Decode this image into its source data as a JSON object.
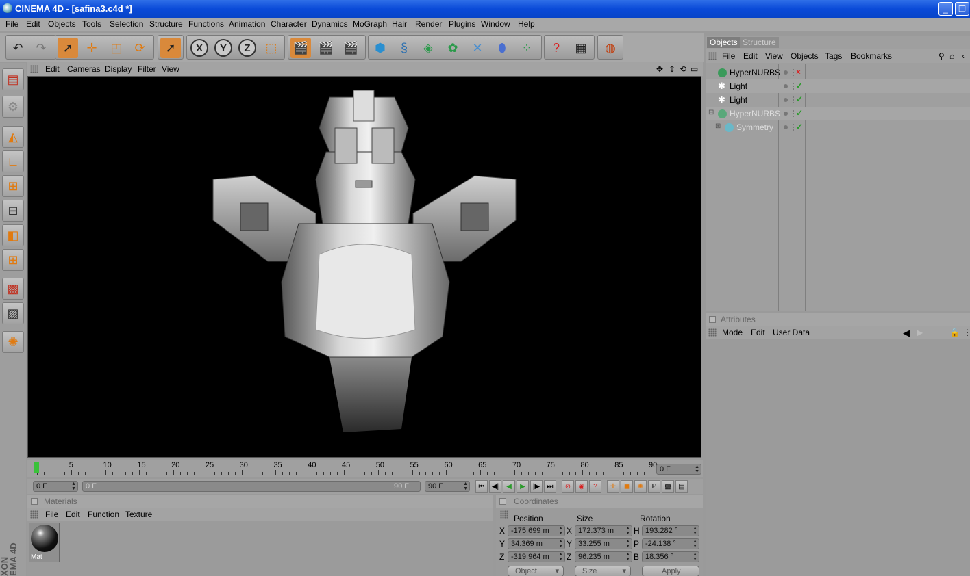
{
  "window": {
    "title": "CINEMA 4D - [safina3.c4d *]"
  },
  "menubar": [
    "File",
    "Edit",
    "Objects",
    "Tools",
    "Selection",
    "Structure",
    "Functions",
    "Animation",
    "Character",
    "Dynamics",
    "MoGraph",
    "Hair",
    "Render",
    "Plugins",
    "Window",
    "Help"
  ],
  "toolbar": {
    "axis_x": "X",
    "axis_y": "Y",
    "axis_z": "Z",
    "icons": [
      "undo-icon",
      "redo-icon",
      "select-arrow-icon",
      "move-icon",
      "scale-icon",
      "rotate-icon",
      "live-select-icon",
      "lock-x-icon",
      "lock-y-icon",
      "lock-z-icon",
      "world-coords-icon",
      "render-view-icon",
      "render-picture-viewer-icon",
      "render-settings-icon",
      "cube-primitive-icon",
      "spline-icon",
      "nurbs-icon",
      "array-icon",
      "deformer-icon",
      "scene-icon",
      "particles-icon",
      "help-icon",
      "table-icon",
      "sphere-globe-icon"
    ]
  },
  "viewport_menu": [
    "Edit",
    "Cameras",
    "Display",
    "Filter",
    "View"
  ],
  "timeline": {
    "ticks": [
      "0",
      "5",
      "10",
      "15",
      "20",
      "25",
      "30",
      "35",
      "40",
      "45",
      "50",
      "55",
      "60",
      "65",
      "70",
      "75",
      "80",
      "85",
      "90"
    ],
    "current_frame": "0 F",
    "range_start": "0 F",
    "range_slider_start": "0 F",
    "range_slider_end": "90 F",
    "range_end": "90 F"
  },
  "materials": {
    "title": "Materials",
    "menu": [
      "File",
      "Edit",
      "Function",
      "Texture"
    ],
    "items": [
      {
        "label": "Mat"
      }
    ]
  },
  "coordinates": {
    "title": "Coordinates",
    "headers": {
      "position": "Position",
      "size": "Size",
      "rotation": "Rotation"
    },
    "rows": [
      {
        "axis": "X",
        "position": "-175.699 m",
        "size_axis": "X",
        "size": "172.373 m",
        "rot_axis": "H",
        "rotation": "193.282 °"
      },
      {
        "axis": "Y",
        "position": "34.369 m",
        "size_axis": "Y",
        "size": "33.255 m",
        "rot_axis": "P",
        "rotation": "-24.138 °"
      },
      {
        "axis": "Z",
        "position": "-319.964 m",
        "size_axis": "Z",
        "size": "96.235 m",
        "rot_axis": "B",
        "rotation": "18.356 °"
      }
    ],
    "mode": "Object",
    "size_mode": "Size",
    "apply": "Apply"
  },
  "objects_panel": {
    "tab_objects": "Objects",
    "tab_structure": "Structure",
    "menu": [
      "File",
      "Edit",
      "View",
      "Objects",
      "Tags",
      "Bookmarks"
    ],
    "tree": [
      {
        "name": "HyperNURBS",
        "icon": "hypernurbs-icon",
        "status": "x",
        "dimmed": false
      },
      {
        "name": "Light",
        "icon": "light-icon",
        "status": "check",
        "dimmed": false
      },
      {
        "name": "Light",
        "icon": "light-icon",
        "status": "check",
        "dimmed": false
      },
      {
        "name": "HyperNURBS",
        "icon": "hypernurbs-icon",
        "status": "check",
        "dimmed": true
      },
      {
        "name": "Symmetry",
        "icon": "symmetry-icon",
        "status": "check",
        "dimmed": true
      }
    ]
  },
  "attributes_panel": {
    "title": "Attributes",
    "menu": [
      "Mode",
      "Edit",
      "User Data"
    ]
  },
  "colors": {
    "accent_orange": "#e07a10",
    "status_red": "#d82020",
    "status_green": "#2a9a2a",
    "titlebar_blue": "#0a4ad8"
  }
}
